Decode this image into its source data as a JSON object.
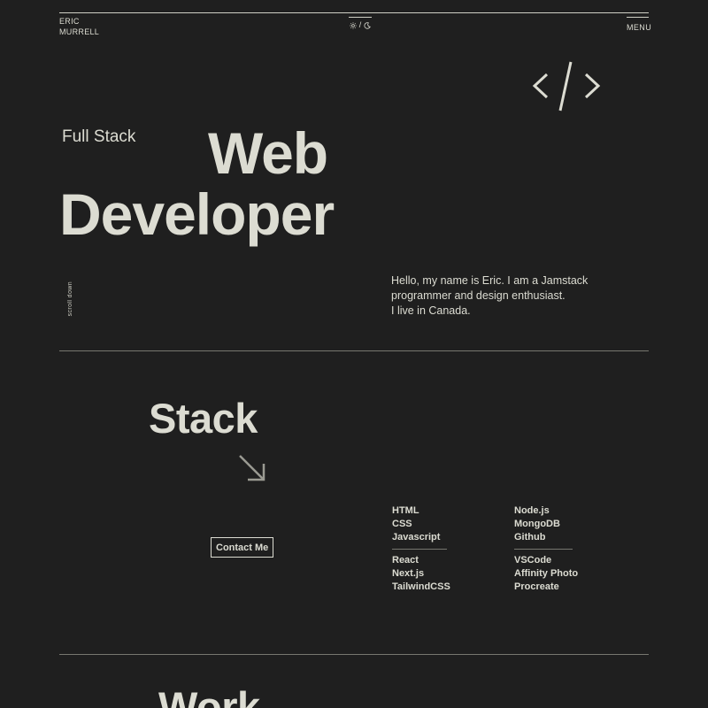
{
  "header": {
    "brand_first": "ERIC",
    "brand_last": "MURRELL",
    "theme_separator": "/",
    "menu_label": "MENU"
  },
  "hero": {
    "subtitle": "Full Stack",
    "title_line1": "Web",
    "title_line2": "Developer",
    "scroll_label": "scroll down",
    "intro_lines": [
      "Hello, my name is Eric. I am a Jamstack",
      "programmer and design enthusiast.",
      "I live in Canada."
    ]
  },
  "stack": {
    "title": "Stack",
    "contact_label": "Contact Me",
    "left_groups": [
      [
        "HTML",
        "CSS",
        "Javascript"
      ],
      [
        "React",
        "Next.js",
        "TailwindCSS"
      ]
    ],
    "right_groups": [
      [
        "Node.js",
        "MongoDB",
        "Github"
      ],
      [
        "VSCode",
        "Affinity Photo",
        "Procreate"
      ]
    ]
  },
  "work": {
    "title": "Work"
  },
  "icons": {
    "theme": [
      "sun-icon",
      "moon-icon"
    ],
    "hero": "code-icon",
    "stack": "arrow-down-right-icon"
  },
  "colors": {
    "background": "#1f1f1f",
    "text": "#dcdcd2",
    "rule": "#77776f"
  }
}
